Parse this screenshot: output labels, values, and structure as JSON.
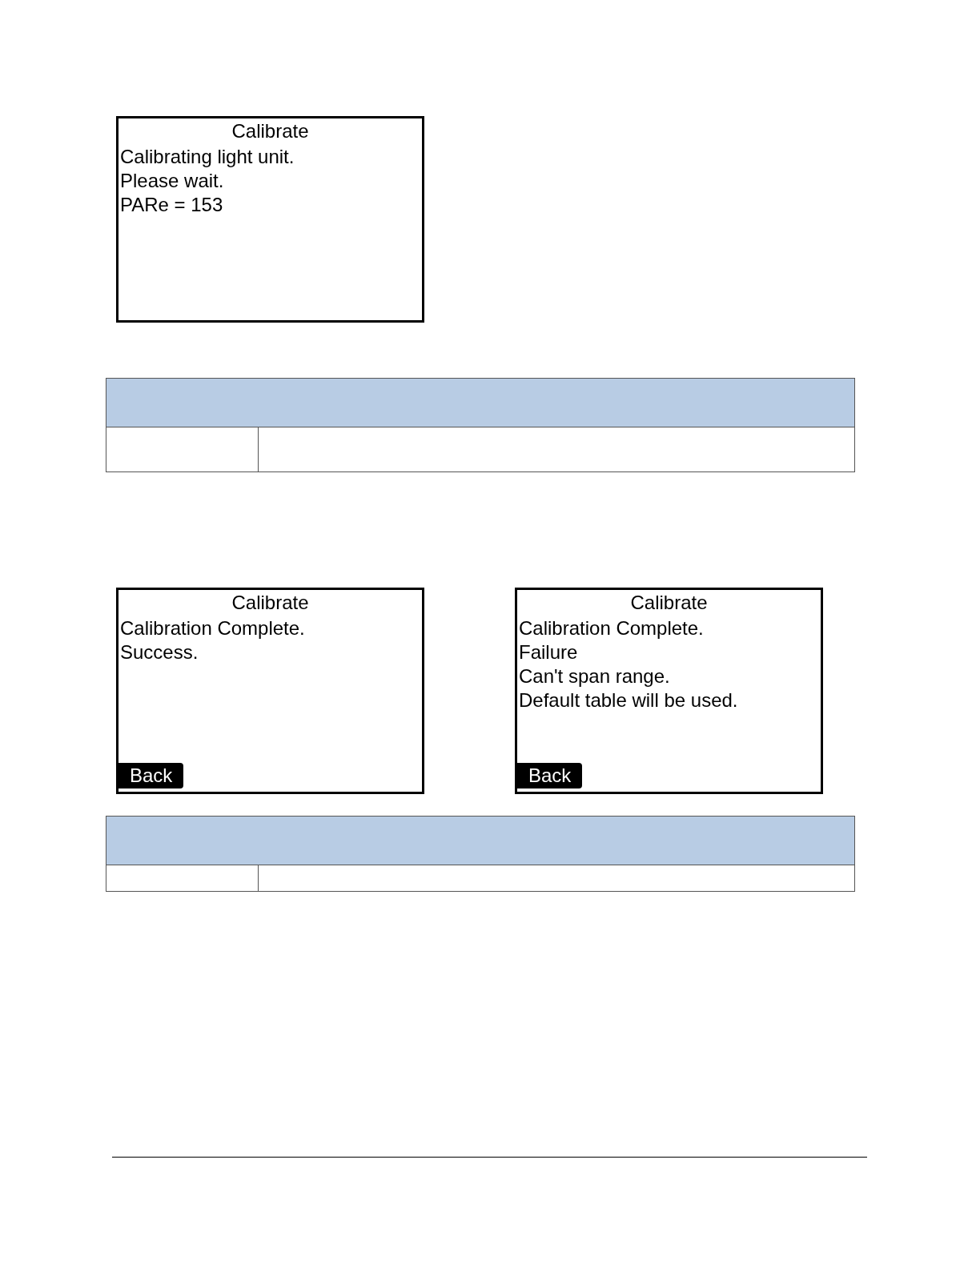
{
  "screens_top": [
    {
      "title": "Calibrate",
      "lines": [
        "Calibrating light unit.",
        "Please wait.",
        "PARe = 153"
      ]
    }
  ],
  "screens_bottom": [
    {
      "title": "Calibrate",
      "lines": [
        "Calibration Complete.",
        "Success."
      ],
      "back_button": "Back"
    },
    {
      "title": "Calibrate",
      "lines": [
        "Calibration Complete.",
        "Failure",
        "Can't span range.",
        "Default table will be used."
      ],
      "back_button": "Back"
    }
  ]
}
